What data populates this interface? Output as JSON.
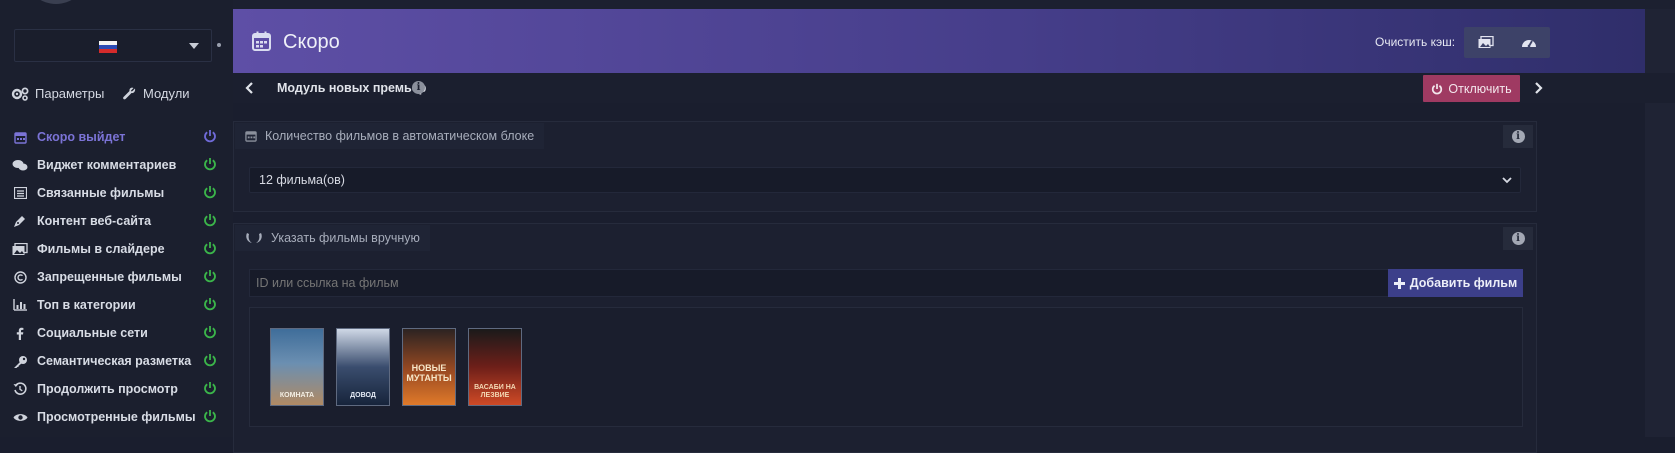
{
  "language": {
    "flag": "ru-flag-icon"
  },
  "sidebar": {
    "tabs": [
      {
        "label": "Параметры",
        "icon": "gears-icon"
      },
      {
        "label": "Модули",
        "icon": "wrench-icon"
      }
    ],
    "items": [
      {
        "label": "Скоро выйдет",
        "icon": "calendar-icon",
        "active": true
      },
      {
        "label": "Виджет комментариев",
        "icon": "comments-icon"
      },
      {
        "label": "Связанные фильмы",
        "icon": "list-icon"
      },
      {
        "label": "Контент веб-сайта",
        "icon": "pen-icon"
      },
      {
        "label": "Фильмы в слайдере",
        "icon": "images-icon"
      },
      {
        "label": "Запрещенные фильмы",
        "icon": "copyright-icon"
      },
      {
        "label": "Топ в категории",
        "icon": "chart-icon"
      },
      {
        "label": "Социальные сети",
        "icon": "facebook-icon"
      },
      {
        "label": "Семантическая разметка",
        "icon": "key-icon"
      },
      {
        "label": "Продолжить просмотр",
        "icon": "history-icon"
      },
      {
        "label": "Просмотренные фильмы",
        "icon": "eye-icon"
      }
    ]
  },
  "header": {
    "title": "Скоро",
    "cache_label": "Очистить кэш:"
  },
  "module": {
    "title": "Модуль новых премьер",
    "disable_label": "Отключить"
  },
  "auto_block": {
    "title": "Количество фильмов в автоматическом блоке",
    "selected": "12 фильма(ов)"
  },
  "manual_block": {
    "title": "Указать фильмы вручную",
    "input_placeholder": "ID или ссылка на фильм",
    "add_label": "Добавить фильм",
    "posters": [
      {
        "caption": "КОМНАТА"
      },
      {
        "caption": "ДОВОД"
      },
      {
        "caption": "НОВЫЕ МУТАНТЫ"
      },
      {
        "caption": "ВАСАБИ НА ЛЕЗВИЕ"
      }
    ]
  },
  "colors": {
    "accent": "#7b73d6",
    "power_on": "#3bb54a",
    "power_active": "#6f6ad8",
    "disable_btn": "#9f3a62",
    "add_btn": "#3c3f8a"
  }
}
